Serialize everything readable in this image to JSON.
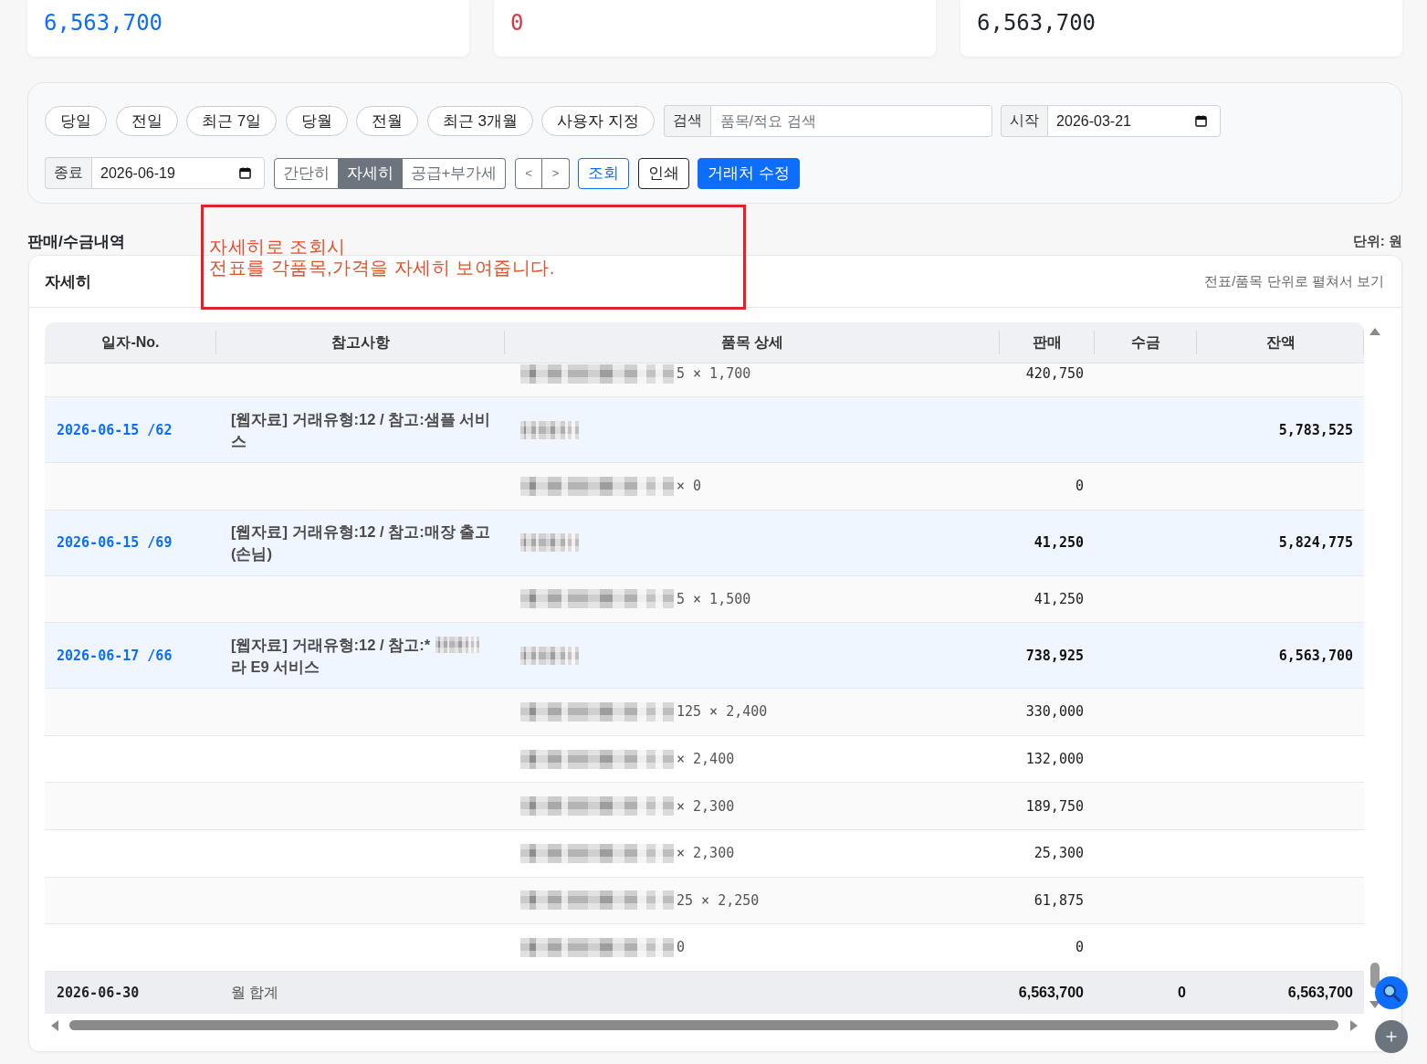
{
  "summary_cards": [
    {
      "value": "6,563,700",
      "color": "#0d6efd"
    },
    {
      "value": "0",
      "color": "#dc3545"
    },
    {
      "value": "6,563,700",
      "color": "#212529"
    }
  ],
  "filters": {
    "quick_ranges": [
      "당일",
      "전일",
      "최근 7일",
      "당월",
      "전월",
      "최근 3개월",
      "사용자 지정"
    ],
    "search": {
      "label": "검색",
      "placeholder": "품목/적요 검색"
    },
    "start_date": {
      "label": "시작",
      "value": "2026-03-21"
    },
    "end_date": {
      "label": "종료",
      "value": "2026-06-19"
    },
    "view_modes": [
      {
        "label": "간단히",
        "selected": false
      },
      {
        "label": "자세히",
        "selected": true
      },
      {
        "label": "공급+부가세",
        "selected": false
      }
    ],
    "pager": [
      "<",
      ">"
    ],
    "actions": [
      {
        "label": "조회",
        "kind": "outline"
      },
      {
        "label": "인쇄",
        "kind": "bordered"
      },
      {
        "label": "거래처 수정",
        "kind": "filled"
      }
    ]
  },
  "section": {
    "title": "판매/수금내역",
    "unit": "단위: 원"
  },
  "annotation": {
    "lines": [
      "자세히로 조회시",
      "전표를 각품목,가격을 자세히 보여줍니다."
    ]
  },
  "panel": {
    "title": "자세히",
    "hint": "전표/품목 단위로 펼쳐서 보기"
  },
  "table": {
    "columns": [
      "일자-No.",
      "참고사항",
      "품목 상세",
      "판매",
      "수금",
      "잔액"
    ],
    "rows": [
      {
        "kind": "item",
        "qty_price": "5 × 1,700",
        "sale": "420,750"
      },
      {
        "kind": "voucher",
        "date_no": "2026-06-15 /62",
        "note": [
          {
            "kind": "text",
            "text": "[웹자료] 거래유형:12 / 참고:샘플 서비스"
          }
        ],
        "balance": "5,783,525"
      },
      {
        "kind": "item",
        "qty_price": "× 0",
        "sale": "0"
      },
      {
        "kind": "voucher",
        "date_no": "2026-06-15 /69",
        "note": [
          {
            "kind": "text",
            "text": "[웹자료] 거래유형:12 / 참고:매장 출고(손님)"
          }
        ],
        "sale": "41,250",
        "balance": "5,824,775"
      },
      {
        "kind": "item",
        "qty_price": "5 × 1,500",
        "sale": "41,250"
      },
      {
        "kind": "voucher",
        "date_no": "2026-06-17 /66",
        "note": [
          {
            "kind": "text",
            "text": "[웹자료] 거래유형:12 / 참고:*"
          },
          {
            "kind": "redacted"
          },
          {
            "kind": "text",
            "text": "라 E9 서비스"
          }
        ],
        "sale": "738,925",
        "balance": "6,563,700"
      },
      {
        "kind": "item",
        "qty_price": "125 × 2,400",
        "sale": "330,000"
      },
      {
        "kind": "item",
        "qty_price": "× 2,400",
        "sale": "132,000"
      },
      {
        "kind": "item",
        "qty_price": "× 2,300",
        "sale": "189,750"
      },
      {
        "kind": "item",
        "qty_price": "× 2,300",
        "sale": "25,300"
      },
      {
        "kind": "item",
        "qty_price": "25 × 2,250",
        "sale": "61,875"
      },
      {
        "kind": "item",
        "qty_price": "0",
        "sale": "0"
      }
    ],
    "total": {
      "date": "2026-06-30",
      "label": "월 합계",
      "sale": "6,563,700",
      "receipt": "0",
      "balance": "6,563,700"
    }
  }
}
